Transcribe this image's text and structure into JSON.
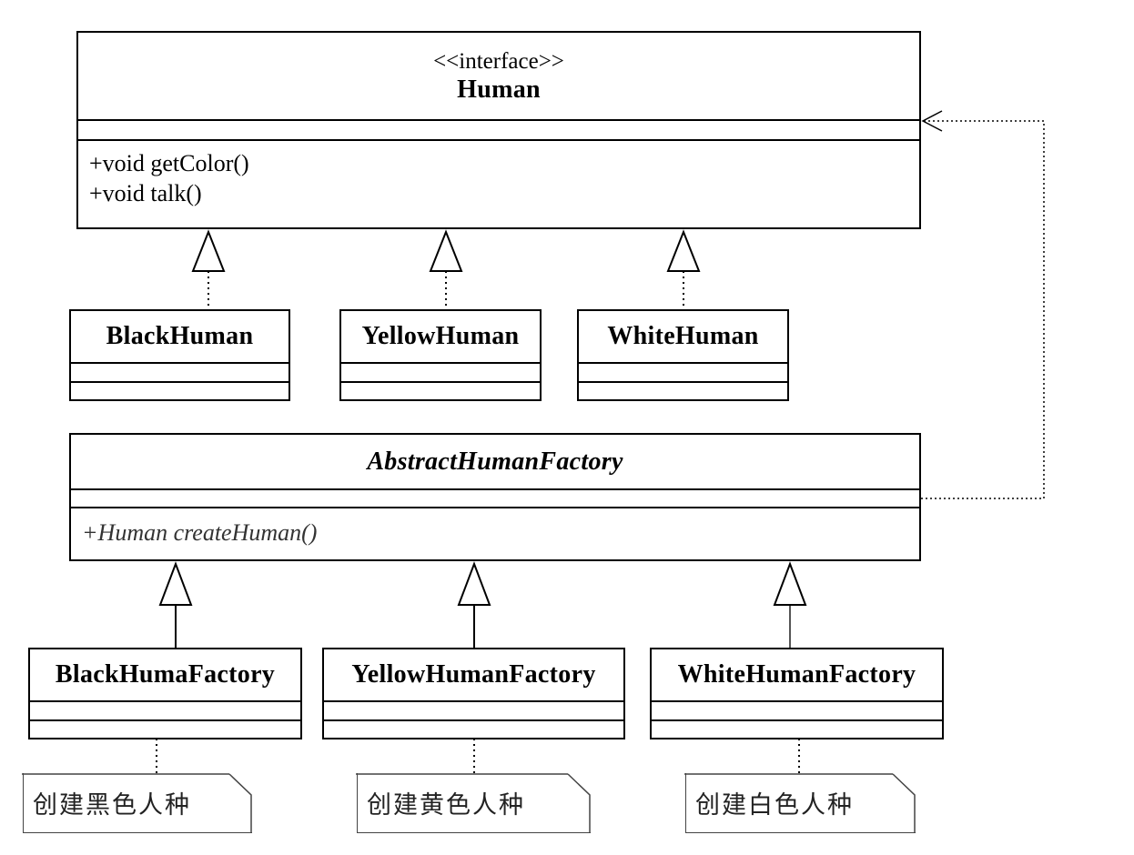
{
  "interface": {
    "stereotype": "<<interface>>",
    "name": "Human",
    "operations": [
      "+void getColor()",
      "+void talk()"
    ]
  },
  "humans": [
    {
      "name": "BlackHuman"
    },
    {
      "name": "YellowHuman"
    },
    {
      "name": "WhiteHuman"
    }
  ],
  "abstract_factory": {
    "name": "AbstractHumanFactory",
    "operations": [
      "+Human createHuman()"
    ]
  },
  "factories": [
    {
      "name": "BlackHumaFactory"
    },
    {
      "name": "YellowHumanFactory"
    },
    {
      "name": "WhiteHumanFactory"
    }
  ],
  "notes": [
    {
      "text": "创建黑色人种"
    },
    {
      "text": "创建黄色人种"
    },
    {
      "text": "创建白色人种"
    }
  ]
}
